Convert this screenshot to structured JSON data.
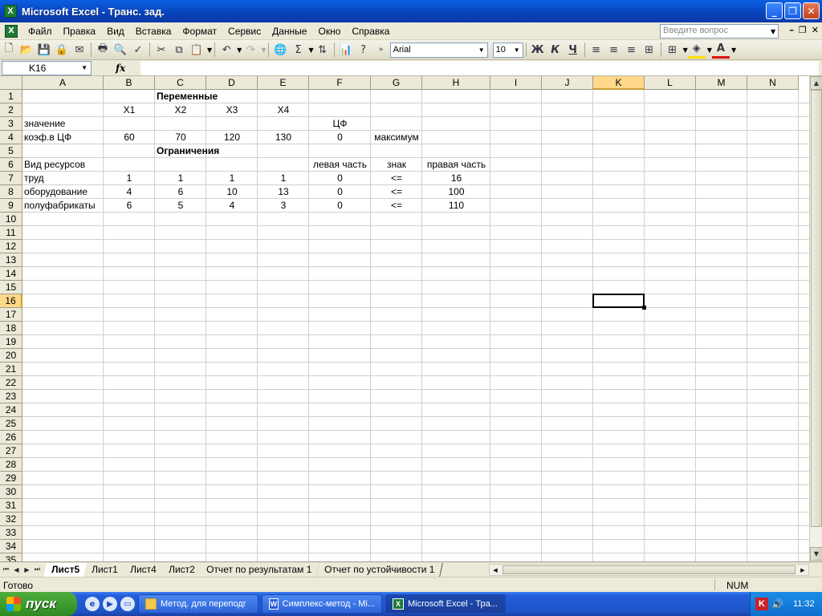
{
  "window": {
    "title": "Microsoft Excel - Транс. зад.",
    "app_icon": "X"
  },
  "menu": {
    "items": [
      "Файл",
      "Правка",
      "Вид",
      "Вставка",
      "Формат",
      "Сервис",
      "Данные",
      "Окно",
      "Справка"
    ],
    "help_placeholder": "Введите вопрос"
  },
  "toolbar": {
    "font": "Arial",
    "size": "10",
    "bold": "Ж",
    "italic": "К",
    "underline": "Ч",
    "sum": "Σ",
    "font_color": "#e01010",
    "fill_color": "#ffe000"
  },
  "formula": {
    "cell_ref": "K16",
    "fx": "fx",
    "content": ""
  },
  "grid": {
    "columns": [
      "A",
      "B",
      "C",
      "D",
      "E",
      "F",
      "G",
      "H",
      "I",
      "J",
      "K",
      "L",
      "M",
      "N"
    ],
    "selected_col": "K",
    "selected_row": "16",
    "rows": [
      "1",
      "2",
      "3",
      "4",
      "5",
      "6",
      "7",
      "8",
      "9",
      "10",
      "11",
      "12",
      "13",
      "14",
      "15",
      "16",
      "17",
      "18",
      "19",
      "20",
      "21",
      "22",
      "23",
      "24",
      "25",
      "26",
      "27",
      "28",
      "29",
      "30",
      "31",
      "32",
      "33",
      "34",
      "35"
    ],
    "cells": {
      "C1": "Переменные",
      "B2": "X1",
      "C2": "X2",
      "D2": "X3",
      "E2": "X4",
      "A3": "значение",
      "F3": "ЦФ",
      "A4": "коэф.в ЦФ",
      "B4": "60",
      "C4": "70",
      "D4": "120",
      "E4": "130",
      "F4": "0",
      "G4": "максимум",
      "C5": "Ограничения",
      "A6": "Вид ресурсов",
      "F6": "левая часть",
      "G6": "знак",
      "H6": "правая часть",
      "A7": "труд",
      "B7": "1",
      "C7": "1",
      "D7": "1",
      "E7": "1",
      "F7": "0",
      "G7": "<=",
      "H7": "16",
      "A8": "оборудование",
      "B8": "4",
      "C8": "6",
      "D8": "10",
      "E8": "13",
      "F8": "0",
      "G8": "<=",
      "H8": "100",
      "A9": "полуфабрикаты",
      "B9": "6",
      "C9": "5",
      "D9": "4",
      "E9": "3",
      "F9": "0",
      "G9": "<=",
      "H9": "110"
    }
  },
  "sheets": {
    "tabs": [
      "Лист5",
      "Лист1",
      "Лист4",
      "Лист2",
      "Отчет по результатам 1",
      "Отчет по устойчивости 1"
    ],
    "active": "Лист5"
  },
  "status": {
    "ready": "Готово",
    "num": "NUM"
  },
  "taskbar": {
    "start": "пуск",
    "tasks": [
      {
        "label": "Метод. для переподг",
        "icon": "folder-icon"
      },
      {
        "label": "Симплекс-метод - Mi...",
        "icon": "word-icon"
      },
      {
        "label": "Microsoft Excel - Тра...",
        "icon": "excel-icon"
      }
    ],
    "time": "11:32"
  }
}
